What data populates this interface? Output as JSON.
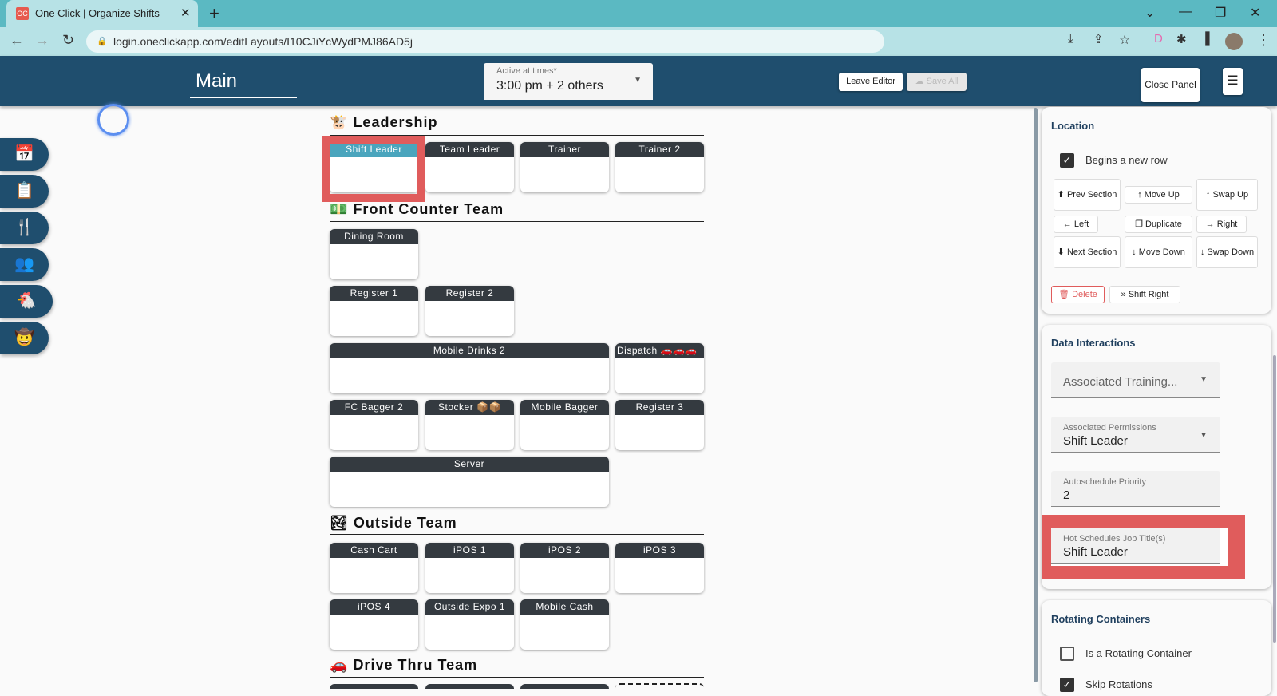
{
  "browser": {
    "tab_title": "One Click | Organize Shifts",
    "favicon_text": "OC",
    "url": "login.oneclickapp.com/editLayouts/I10CJiYcWydPMJ86AD5j"
  },
  "header": {
    "layout_name": "Main",
    "active_label": "Active at times*",
    "active_value": "3:00 pm + 2 others",
    "leave_editor": "Leave Editor",
    "save_all": "Save All",
    "close_panel": "Close Panel",
    "menu": "☰"
  },
  "sidebar": {
    "items": [
      {
        "icon": "calendar-icon",
        "glyph": "📅"
      },
      {
        "icon": "clipboard-icon",
        "glyph": "📋"
      },
      {
        "icon": "utensils-icon",
        "glyph": "🍴"
      },
      {
        "icon": "users-icon",
        "glyph": "👥"
      },
      {
        "icon": "chicken-icon",
        "glyph": "🐔"
      },
      {
        "icon": "cowboy-hat-icon",
        "glyph": "🤠"
      }
    ]
  },
  "sections": [
    {
      "title": "Leadership",
      "emoji": "🐮",
      "cards": [
        "Shift Leader",
        "Team Leader",
        "Trainer",
        "Trainer 2"
      ]
    },
    {
      "title": "Front Counter Team",
      "emoji": "💵",
      "cards": [
        "Dining Room",
        "Register 1",
        "Register 2",
        "Mobile Drinks 2",
        "Dispatch 🚗🚗🚗",
        "FC Bagger 2",
        "Stocker 📦📦",
        "Mobile Bagger",
        "Register 3",
        "Server"
      ]
    },
    {
      "title": "Outside Team",
      "emoji": "🏞",
      "cards": [
        "Cash Cart",
        "iPOS 1",
        "iPOS 2",
        "iPOS 3",
        "iPOS 4",
        "Outside Expo 1",
        "Mobile Cash"
      ]
    },
    {
      "title": "Drive Thru Team",
      "emoji": "🚗",
      "cards": []
    }
  ],
  "panel": {
    "location": {
      "title": "Location",
      "begins_new_row": "Begins a new row",
      "begins_new_row_checked": true,
      "buttons": {
        "prev_section": "Prev Section",
        "move_up": "Move Up",
        "swap_up": "Swap Up",
        "left": "Left",
        "duplicate": "Duplicate",
        "right": "Right",
        "next_section": "Next Section",
        "move_down": "Move Down",
        "swap_down": "Swap Down",
        "delete": "Delete",
        "shift_right": "Shift Right"
      }
    },
    "data_interactions": {
      "title": "Data Interactions",
      "associated_training_placeholder": "Associated Training...",
      "associated_permissions_label": "Associated Permissions",
      "associated_permissions_value": "Shift Leader",
      "autoschedule_label": "Autoschedule Priority",
      "autoschedule_value": "2",
      "hot_schedules_label": "Hot Schedules Job Title(s)",
      "hot_schedules_value": "Shift Leader"
    },
    "rotating": {
      "title": "Rotating Containers",
      "is_rotating": "Is a Rotating Container",
      "is_rotating_checked": false,
      "skip_rotations": "Skip Rotations",
      "skip_rotations_checked": true
    }
  },
  "colors": {
    "header": "#1f4e6e",
    "card_header": "#343a40",
    "selected": "#4aa5bd",
    "highlight": "#e05c5c"
  }
}
